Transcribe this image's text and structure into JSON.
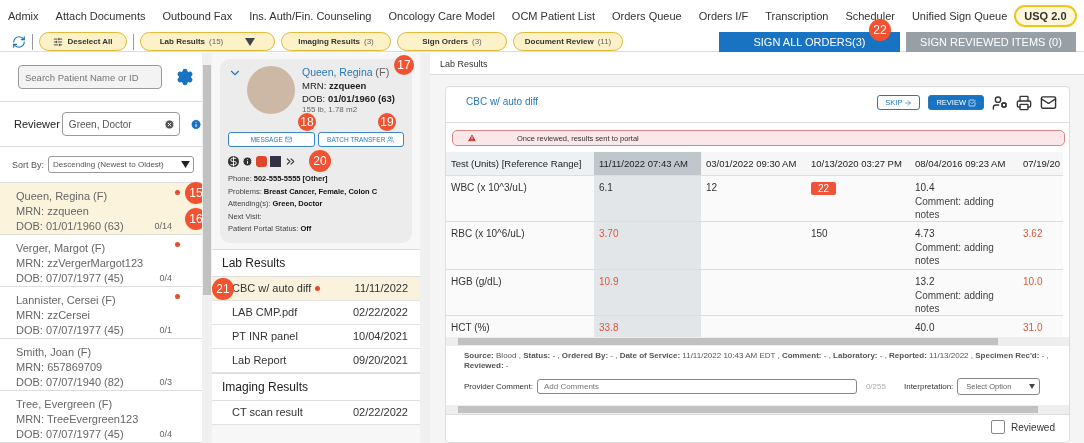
{
  "nav": [
    {
      "label": "Admix",
      "selected": false
    },
    {
      "label": "Attach Documents",
      "selected": false
    },
    {
      "label": "Outbound Fax",
      "selected": false
    },
    {
      "label": "Ins. Auth/Fin. Counseling",
      "selected": false
    },
    {
      "label": "Oncology Care Model",
      "selected": false
    },
    {
      "label": "OCM Patient List",
      "selected": false
    },
    {
      "label": "Orders Queue",
      "selected": false
    },
    {
      "label": "Orders I/F",
      "selected": false
    },
    {
      "label": "Transcription",
      "selected": false
    },
    {
      "label": "Scheduler",
      "selected": false
    },
    {
      "label": "Unified Sign Queue",
      "selected": false
    },
    {
      "label": "USQ 2.0",
      "selected": true
    }
  ],
  "toolbar": {
    "deselect": "Deselect All",
    "filters": [
      {
        "label": "Lab Results",
        "count": "(15)",
        "dropdown": true
      },
      {
        "label": "Imaging Results",
        "count": "(3)",
        "dropdown": false
      },
      {
        "label": "Sign Orders",
        "count": "(3)",
        "dropdown": false
      },
      {
        "label": "Document Review",
        "count": "(11)",
        "dropdown": false
      }
    ],
    "sign_all": {
      "label": "SIGN ALL ORDERS(3)",
      "disabled": false,
      "marker": "22"
    },
    "sign_reviewed": {
      "label": "SIGN REVIEWED ITEMS (0)",
      "disabled": true
    }
  },
  "sidebar": {
    "search": {
      "placeholder": "Search Patient Name or ID"
    },
    "reviewer": {
      "label": "Reviewer",
      "value": "Green, Doctor"
    },
    "sort": {
      "label": "Sort By:",
      "value": "Descending (Newest to Oldest)"
    },
    "patients": [
      {
        "name": "Queen, Regina (F)",
        "mrn": "MRN: zzqueen",
        "dob": "DOB: 01/01/1960 (63)",
        "count": "0/14",
        "unread": true,
        "selected": true,
        "marker_name": "15",
        "marker_count": "16"
      },
      {
        "name": "Verger, Margot (F)",
        "mrn": "MRN: zzVergerMargot123",
        "dob": "DOB: 07/07/1977 (45)",
        "count": "0/4",
        "unread": true,
        "selected": false
      },
      {
        "name": "Lannister, Cersei (F)",
        "mrn": "MRN: zzCersei",
        "dob": "DOB: 07/07/1977 (45)",
        "count": "0/1",
        "unread": true,
        "selected": false
      },
      {
        "name": "Smith, Joan (F)",
        "mrn": "MRN: 657869709",
        "dob": "DOB: 07/07/1940 (82)",
        "count": "0/3",
        "unread": false,
        "selected": false
      },
      {
        "name": "Tree, Evergreen (F)",
        "mrn": "MRN: TreeEvergreen123",
        "dob": "DOB: 07/07/1977 (45)",
        "count": "0/4",
        "unread": false,
        "selected": false
      }
    ]
  },
  "patient_card": {
    "name": "Queen, Regina",
    "sex": "(F)",
    "mrn_label": "MRN:",
    "mrn": "zzqueen",
    "dob_label": "DOB:",
    "dob": "01/01/1960 (63)",
    "vitals": "155 lb, 1.78 m2",
    "marker": "17",
    "message": {
      "label": "MESSAGE",
      "marker": "18"
    },
    "batch": {
      "label": "BATCH TRANSFER",
      "marker": "19"
    },
    "icons_marker": "20",
    "details": [
      {
        "label": "Phone:",
        "value": "502-555-5555 [Other]"
      },
      {
        "label": "Problems:",
        "value": "Breast Cancer, Female, Colon C"
      },
      {
        "label": "Attending(s):",
        "value": "Green, Doctor"
      },
      {
        "label": "Next Visit:"
      },
      {
        "label": "Patient Portal Status:",
        "value": "Off"
      }
    ]
  },
  "item_groups": [
    {
      "title": "Lab Results",
      "items": [
        {
          "name": "CBC w/ auto diff",
          "date": "11/11/2022",
          "unread": true,
          "selected": true,
          "marker": "21"
        },
        {
          "name": "LAB CMP.pdf",
          "date": "02/22/2022",
          "unread": false,
          "selected": false
        },
        {
          "name": "PT INR panel",
          "date": "10/04/2021",
          "unread": false,
          "selected": false
        },
        {
          "name": "Lab Report",
          "date": "09/20/2021",
          "unread": false,
          "selected": false
        }
      ]
    },
    {
      "title": "Imaging Results",
      "items": [
        {
          "name": "CT scan result",
          "date": "02/22/2022",
          "unread": false,
          "selected": false
        }
      ]
    }
  ],
  "detail": {
    "section_title": "Lab Results",
    "title": "CBC w/ auto diff",
    "skip": "SKIP",
    "review": "REVIEW",
    "warning": "Once reviewed, results sent to portal",
    "table": {
      "columns": [
        {
          "label": "Test (Units) [Reference Range]",
          "selected": false
        },
        {
          "label": "11/11/2022 07:43 AM",
          "selected": true
        },
        {
          "label": "03/01/2022 09:30 AM",
          "selected": false
        },
        {
          "label": "10/13/2020 03:27 PM",
          "selected": false
        },
        {
          "label": "08/04/2016 09:23 AM",
          "selected": false
        },
        {
          "label": "07/19/20",
          "selected": false
        }
      ],
      "rows": [
        {
          "cells": [
            {
              "kind": "test",
              "value": "WBC (x 10^3/uL)"
            },
            {
              "kind": "normal",
              "value": "6.1"
            },
            {
              "kind": "normal",
              "value": "12"
            },
            {
              "kind": "critical",
              "value": "22"
            },
            {
              "kind": "normal",
              "value": "10.4",
              "comment": "Comment: adding notes"
            },
            {
              "kind": "empty"
            }
          ]
        },
        {
          "cells": [
            {
              "kind": "test",
              "value": "RBC (x 10^6/uL)"
            },
            {
              "kind": "abnormal",
              "value": "3.70"
            },
            {
              "kind": "empty"
            },
            {
              "kind": "normal",
              "value": "150"
            },
            {
              "kind": "normal",
              "value": "4.73",
              "comment": "Comment: adding notes"
            },
            {
              "kind": "abnormal",
              "value": "3.62"
            }
          ]
        },
        {
          "cells": [
            {
              "kind": "test",
              "value": "HGB (g/dL)"
            },
            {
              "kind": "abnormal",
              "value": "10.9"
            },
            {
              "kind": "empty"
            },
            {
              "kind": "empty"
            },
            {
              "kind": "normal",
              "value": "13.2",
              "comment": "Comment: adding notes"
            },
            {
              "kind": "abnormal",
              "value": "10.0"
            }
          ]
        },
        {
          "cells": [
            {
              "kind": "test",
              "value": "HCT (%)"
            },
            {
              "kind": "abnormal",
              "value": "33.8"
            },
            {
              "kind": "empty"
            },
            {
              "kind": "empty"
            },
            {
              "kind": "normal",
              "value": "40.0"
            },
            {
              "kind": "abnormal",
              "value": "31.0"
            }
          ]
        }
      ]
    },
    "source_line": "**Source:** Blood , **Status:** - , **Ordered By:** - , **Date of Service:** 11/11/2022 10:43 AM EDT , **Comment:** - , **Laboratory:** - , **Reported:** 11/13/2022 , **Specimen Rec'd:** - , **Reviewed:** -",
    "provider_comment": {
      "label": "Provider Comment:",
      "placeholder": "Add Comments",
      "counter": "0/255"
    },
    "interpretation": {
      "label": "Interpretation:",
      "placeholder": "Select Option"
    },
    "reviewed": {
      "label": "Reviewed",
      "checked": false
    }
  }
}
